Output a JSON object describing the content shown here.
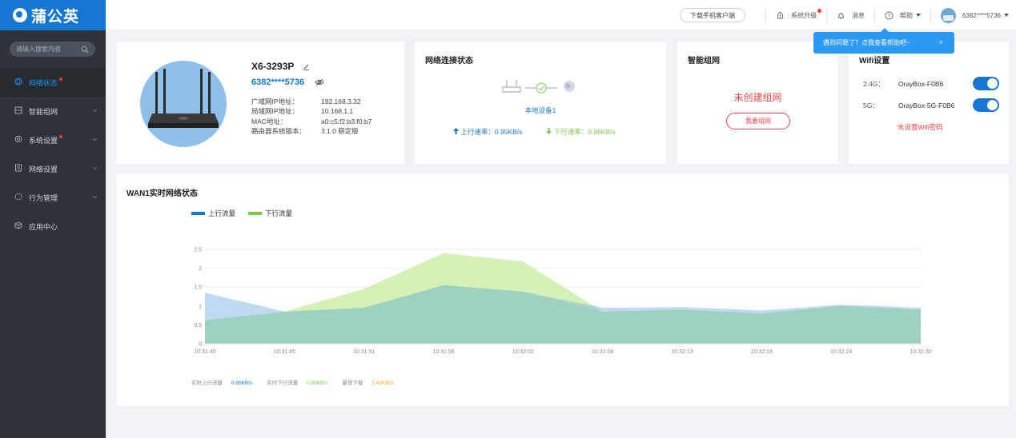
{
  "brand": {
    "name": "蒲公英"
  },
  "sidebar": {
    "search_placeholder": "请输入搜索内容",
    "items": [
      {
        "label": "网络状态",
        "active": true,
        "dot": true
      },
      {
        "label": "智能组网",
        "active": false,
        "dot": false
      },
      {
        "label": "系统设置",
        "active": false,
        "dot": true
      },
      {
        "label": "网络设置",
        "active": false,
        "dot": false
      },
      {
        "label": "行为管理",
        "active": false,
        "dot": false
      },
      {
        "label": "应用中心",
        "active": false,
        "dot": false
      }
    ]
  },
  "header": {
    "download_label": "下载手机客户端",
    "upgrade_label": "系统升级",
    "message_label": "消息",
    "help_label": "帮助",
    "user_label": "6382****5736"
  },
  "tooltip": {
    "text": "遇到问题了？点我查看帮助吧~",
    "close": "×"
  },
  "device": {
    "name": "X6-3293P",
    "id": "6382****5736",
    "info": [
      {
        "key": "广域网IP地址：",
        "value": "192.168.3.32"
      },
      {
        "key": "局域网IP地址：",
        "value": "10.168.1.1"
      },
      {
        "key": "MAC地址：",
        "value": "a0:c5:f2:b3:f0:b7"
      },
      {
        "key": "路由器系统版本：",
        "value": "3.1.0 稳定版"
      }
    ]
  },
  "network": {
    "title": "网络连接状态",
    "local_device": "本地设备1",
    "up_speed": "上行速率：0.95KB/s",
    "down_speed": "下行速率：0.86KB/s"
  },
  "mesh": {
    "title": "智能组网",
    "status": "未创建组网",
    "button": "我要组网"
  },
  "wifi": {
    "title": "Wifi设置",
    "bands": [
      {
        "band": "2.4G：",
        "ssid": "OrayBox-F0B6"
      },
      {
        "band": "5G：",
        "ssid": "OrayBox-5G-F0B6"
      }
    ],
    "password_warning": "未设置Wifi密码"
  },
  "chart_data": {
    "type": "area",
    "title": "WAN1实时网络状态",
    "x": [
      "10:31:40",
      "10:31:45",
      "10:31:51",
      "10:31:56",
      "10:32:02",
      "10:32:08",
      "10:32:13",
      "10:32:19",
      "10:32:24",
      "10:32:30"
    ],
    "ylim": [
      0,
      2.5
    ],
    "yticks": [
      "0",
      "0.5",
      "1",
      "1.5",
      "2",
      "2.5"
    ],
    "series": [
      {
        "name": "上行流量",
        "color": "#1478d2",
        "values": [
          1.35,
          0.85,
          0.95,
          1.55,
          1.38,
          0.95,
          0.97,
          0.88,
          1.03,
          0.95
        ]
      },
      {
        "name": "下行流量",
        "color": "#7ec84c",
        "values": [
          0.62,
          0.85,
          1.45,
          2.4,
          2.18,
          0.85,
          0.9,
          0.8,
          1.0,
          0.9
        ]
      }
    ],
    "grid": true,
    "legend": "top-left"
  },
  "stats": {
    "up_label": "实时上行流量",
    "up_value": "0.95KB/s",
    "down_label": "实时下行流量",
    "down_value": "0.86KB/s",
    "max_label": "最快下载",
    "max_value": "2.42KB/S"
  }
}
